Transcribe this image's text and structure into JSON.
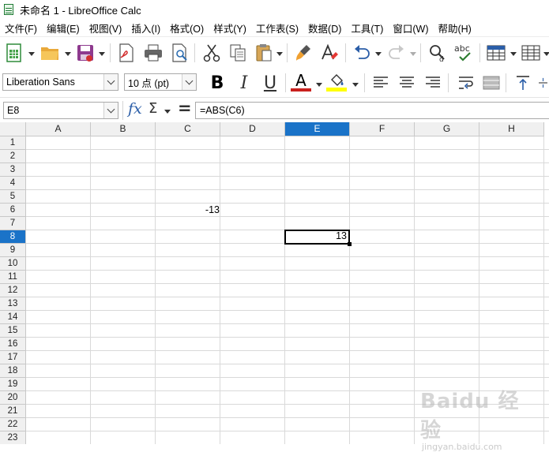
{
  "window": {
    "title": "未命名 1 - LibreOffice Calc"
  },
  "menu": [
    "文件(F)",
    "编辑(E)",
    "视图(V)",
    "插入(I)",
    "格式(O)",
    "样式(Y)",
    "工作表(S)",
    "数据(D)",
    "工具(T)",
    "窗口(W)",
    "帮助(H)"
  ],
  "toolbar": {
    "font_name": "Liberation Sans",
    "font_size": "10 点 (pt)",
    "bold": "B",
    "italic": "I",
    "underline": "U",
    "font_color_letter": "A",
    "font_color": "#c9211e",
    "highlight_color": "#ffff00",
    "spelling_label": "abc"
  },
  "formula_bar": {
    "name_box": "E8",
    "fx_symbol": "fx",
    "sum_symbol": "Σ",
    "equals_symbol": "=",
    "formula": "=ABS(C6)"
  },
  "sheet": {
    "columns": [
      "A",
      "B",
      "C",
      "D",
      "E",
      "F",
      "G",
      "H"
    ],
    "selected_column": "E",
    "rows": [
      "1",
      "2",
      "3",
      "4",
      "5",
      "6",
      "7",
      "8",
      "9",
      "10",
      "11",
      "12",
      "13",
      "14",
      "15",
      "16",
      "17",
      "18",
      "19",
      "20",
      "21",
      "22",
      "23"
    ],
    "selected_row": "8",
    "cells": {
      "C6": "-13",
      "E8": "13"
    }
  },
  "watermark": {
    "logo": "Baidu 经验",
    "url": "jingyan.baidu.com"
  }
}
